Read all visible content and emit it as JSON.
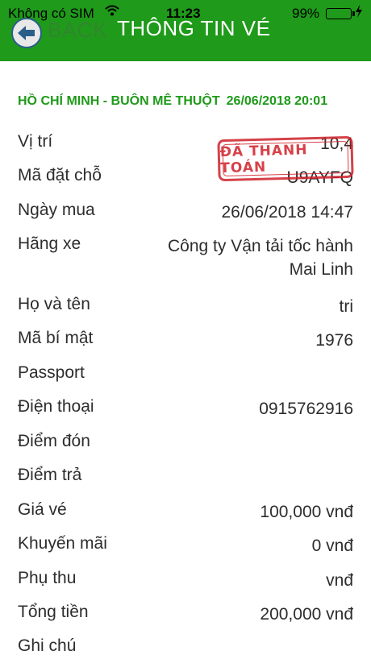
{
  "status_bar": {
    "carrier": "Không có SIM",
    "time": "11:23",
    "battery": "99%",
    "battery_level": 0.99,
    "wifi_icon": "wifi-icon",
    "charging_icon": "bolt-icon"
  },
  "header": {
    "back_label": "BACK",
    "title": "THÔNG TIN VÉ",
    "background": "#1f9a1a"
  },
  "ticket": {
    "route": "HỒ CHÍ MINH - BUÔN MÊ THUỘT",
    "departure": "26/06/2018 20:01",
    "stamp": "ĐÃ THANH TOÁN",
    "rows": [
      {
        "label": "Vị trí",
        "value": "10,4"
      },
      {
        "label": "Mã đặt chỗ",
        "value": "U9AYFQ"
      },
      {
        "label": "Ngày mua",
        "value": "26/06/2018 14:47"
      },
      {
        "label": "Hãng xe",
        "value": "Công ty Vận tải tốc hành Mai Linh"
      },
      {
        "label": "Họ và tên",
        "value": "tri"
      },
      {
        "label": "Mã bí mật",
        "value": "1976"
      },
      {
        "label": "Passport",
        "value": ""
      },
      {
        "label": "Điện thoại",
        "value": "0915762916"
      },
      {
        "label": "Điểm đón",
        "value": ""
      },
      {
        "label": "Điểm trả",
        "value": ""
      },
      {
        "label": "Giá vé",
        "value": "100,000 vnđ"
      },
      {
        "label": "Khuyến mãi",
        "value": "0 vnđ"
      },
      {
        "label": "Phụ thu",
        "value": "vnđ"
      },
      {
        "label": "Tổng tiền",
        "value": "200,000 vnđ"
      },
      {
        "label": "Ghi chú",
        "value": ""
      }
    ]
  }
}
